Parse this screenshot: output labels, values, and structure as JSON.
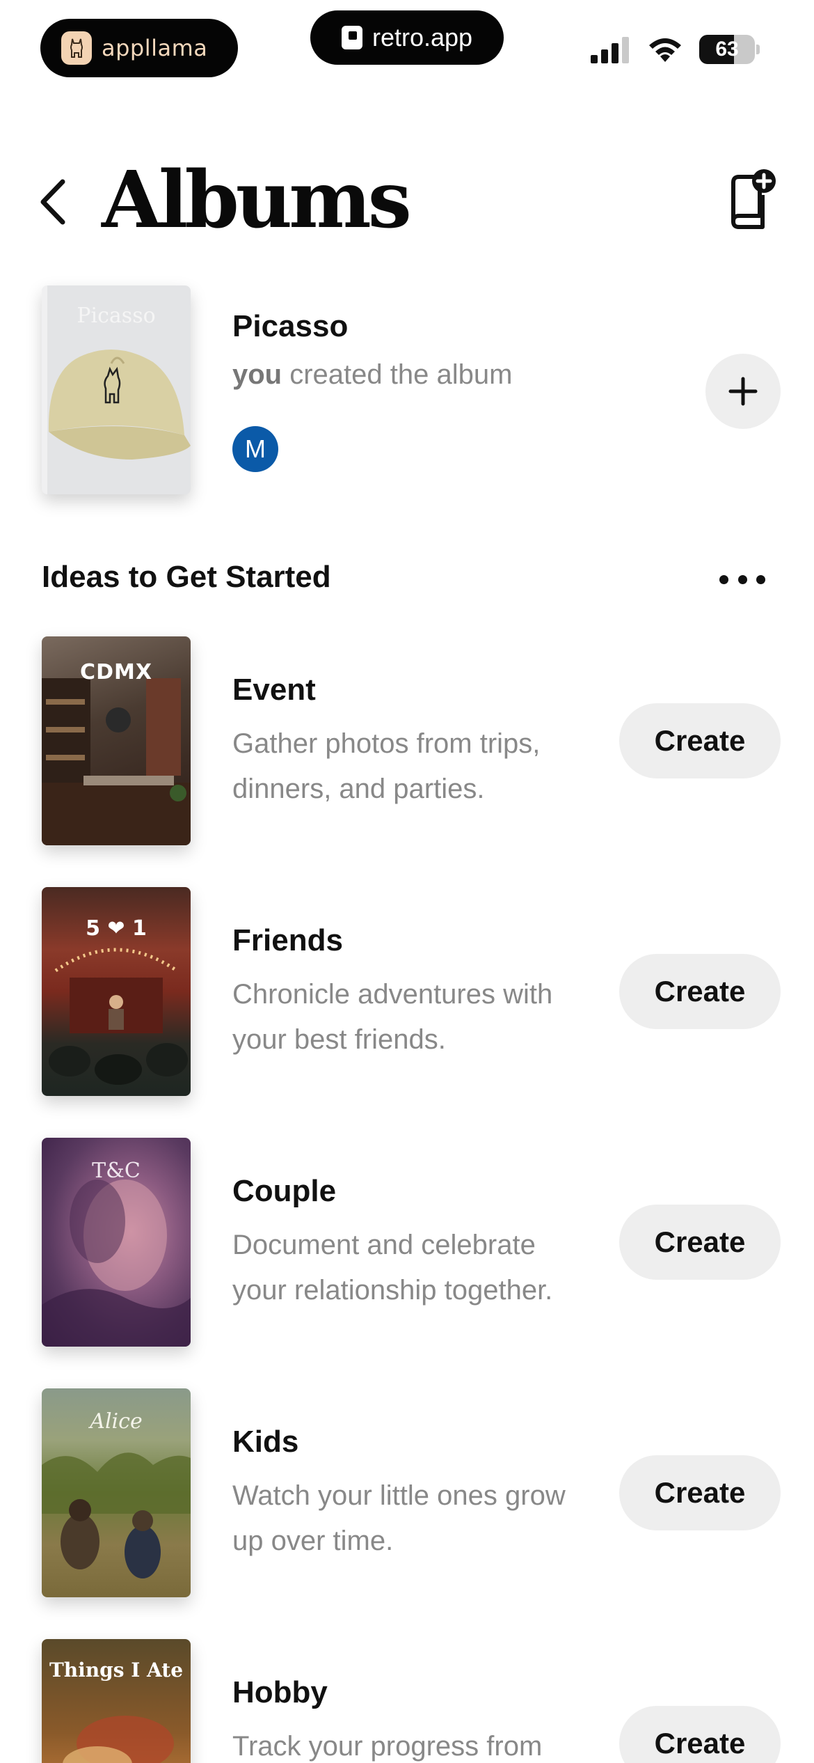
{
  "status_bar": {
    "left_pill_label": "appllama",
    "center_pill_label": "retro.app",
    "battery_percent": "63",
    "battery_level": 0.63,
    "icons": [
      "cellular-signal-icon",
      "wifi-icon",
      "battery-icon"
    ]
  },
  "header": {
    "title": "Albums",
    "back_icon": "chevron-left-icon",
    "new_album_icon": "book-plus-icon"
  },
  "album": {
    "name": "Picasso",
    "subtitle_actor": "you",
    "subtitle_rest": " created the album",
    "cover_text": "Picasso",
    "avatar_initial": "M",
    "add_icon": "plus-icon"
  },
  "ideas": {
    "section_title": "Ideas to Get Started",
    "more_icon": "ellipsis-icon",
    "create_label": "Create",
    "items": [
      {
        "name": "Event",
        "description": "Gather photos from trips, dinners, and parties.",
        "cover_text": "CDMX"
      },
      {
        "name": "Friends",
        "description": "Chronicle adventures with your best friends.",
        "cover_text": "5 ❤ 1"
      },
      {
        "name": "Couple",
        "description": "Document and celebrate your relationship together.",
        "cover_text": "T&C"
      },
      {
        "name": "Kids",
        "description": "Watch your little ones grow up over time.",
        "cover_text": "Alice"
      },
      {
        "name": "Hobby",
        "description": "Track your progress from",
        "cover_text": "Things I Ate"
      }
    ]
  },
  "colors": {
    "avatar": "#0b5aa8",
    "button_bg": "#eeeeee",
    "muted_text": "#888888"
  }
}
